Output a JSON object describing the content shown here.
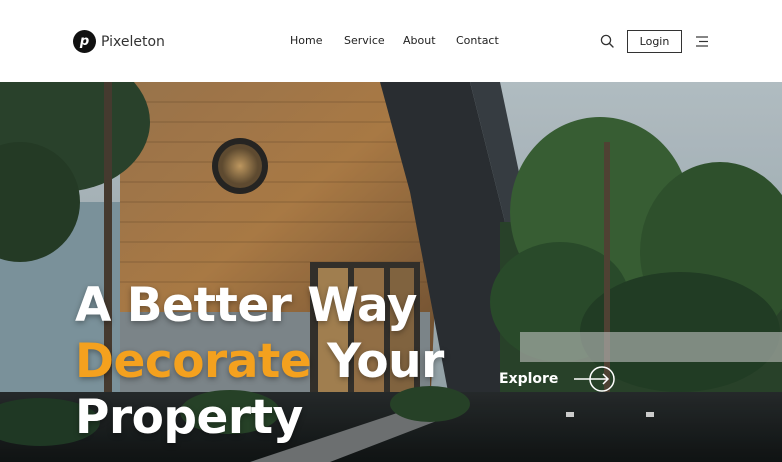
{
  "brand": {
    "logo_letter": "p",
    "name": "Pixeleton"
  },
  "nav": {
    "items": [
      "Home",
      "Service",
      "About",
      "Contact"
    ]
  },
  "header": {
    "login_label": "Login",
    "search_icon": "search-icon",
    "menu_icon": "hamburger-menu-icon"
  },
  "hero": {
    "line1": "A Better Way",
    "line2_accent": "Decorate",
    "line2_rest": " Your",
    "line3": "Property",
    "explore_label": "Explore",
    "explore_icon": "arrow-right-circle-icon"
  },
  "colors": {
    "accent": "#f4a11e",
    "text_dark": "#222222",
    "hero_text": "#ffffff"
  }
}
